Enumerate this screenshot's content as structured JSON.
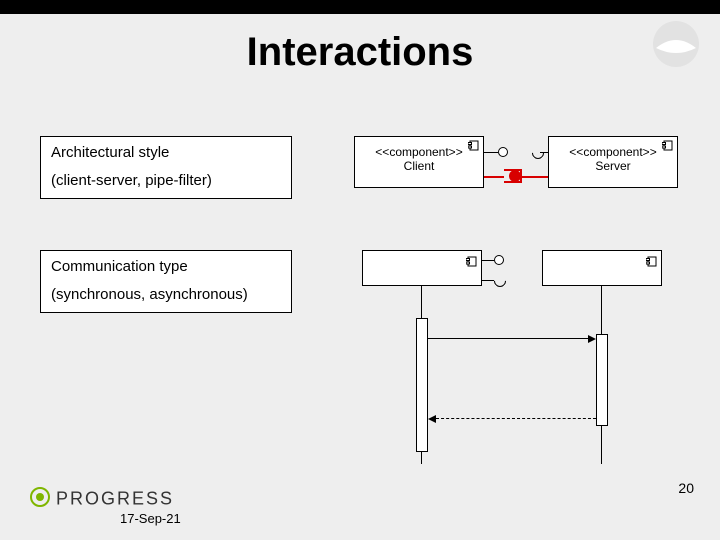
{
  "slide": {
    "title": "Interactions",
    "page_number": "20",
    "date": "17-Sep-21"
  },
  "callouts": {
    "arch": {
      "main": "Architectural style",
      "sub": "(client-server, pipe-filter)"
    },
    "comm": {
      "main": "Communication type",
      "sub": "(synchronous, asynchronous)"
    }
  },
  "components": {
    "client": {
      "stereotype": "<<component>>",
      "name": "Client"
    },
    "server": {
      "stereotype": "<<component>>",
      "name": "Server"
    }
  },
  "brand": {
    "name": "PROGRESS"
  }
}
